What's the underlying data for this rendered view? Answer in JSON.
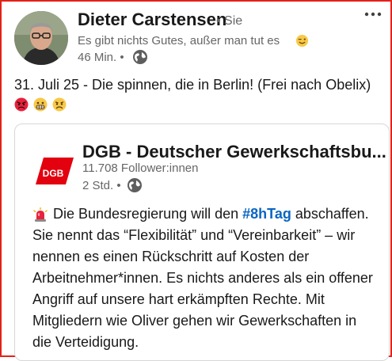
{
  "post": {
    "author": {
      "name": "Dieter Carstensen",
      "relation": "• Sie",
      "subtitle": "Es gibt nichts Gutes, außer man tut es",
      "time": "46 Min. •"
    },
    "text": "31. Juli 25 - Die spinnen, die in Berlin! (Frei nach Obelix)",
    "emojis": [
      "angry-face-icon",
      "grimacing-face-icon",
      "sad-face-icon"
    ]
  },
  "shared": {
    "org": {
      "name": "DGB - Deutscher Gewerkschaftsbu...",
      "logo_text": "DGB",
      "followers": "11.708 Follower:innen",
      "time": "2 Std. •"
    },
    "body": {
      "line1_before": "Die Bundesregierung will den ",
      "hashtag": "#8hTag",
      "line1_after": " abschaffen.",
      "lines": [
        "Sie nennt das “Flexibilität” und “Vereinbarkeit” – wir",
        "nennen es einen Rückschritt auf Kosten der",
        "Arbeitnehmer*innen. Es nichts anderes als ein offener",
        "Angriff auf unsere hart erkämpften Rechte. Mit",
        "Mitgliedern wie Oliver gehen wir Gewerkschaften in",
        "die Verteidigung."
      ]
    }
  },
  "colors": {
    "frame": "#e32119",
    "link": "#0a66c2",
    "dgb_red": "#e3000f"
  }
}
